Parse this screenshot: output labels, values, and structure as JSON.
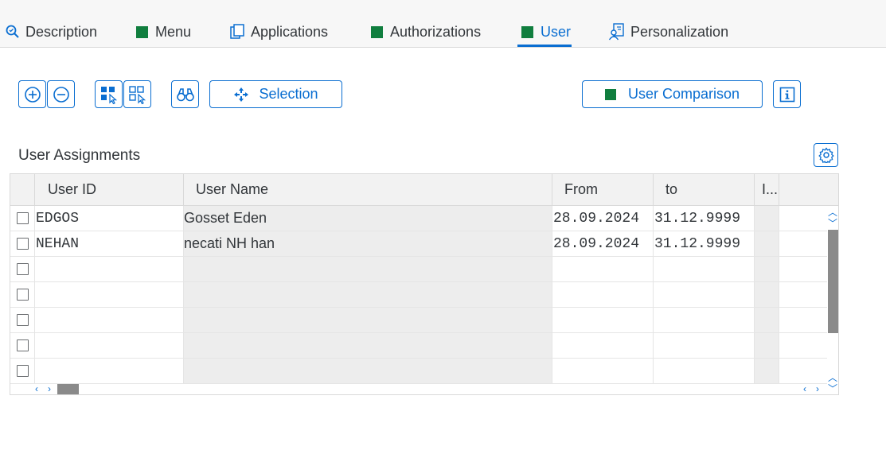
{
  "tabs": [
    {
      "label": "Description",
      "icon": "magnifier-icon"
    },
    {
      "label": "Menu",
      "icon": "green-square-icon"
    },
    {
      "label": "Applications",
      "icon": "copy-pages-icon"
    },
    {
      "label": "Authorizations",
      "icon": "green-square-icon"
    },
    {
      "label": "User",
      "icon": "green-square-icon",
      "active": true
    },
    {
      "label": "Personalization",
      "icon": "user-settings-icon"
    }
  ],
  "toolbar": {
    "selection_label": "Selection",
    "user_comparison_label": "User Comparison"
  },
  "section": {
    "title": "User Assignments"
  },
  "table": {
    "columns": [
      "User ID",
      "User Name",
      "From",
      "to",
      "I..."
    ],
    "rows": [
      {
        "user_id": "EDGOS",
        "user_name": "Gosset Eden",
        "from": "28.09.2024",
        "to": "31.12.9999"
      },
      {
        "user_id": "NEHAN",
        "user_name": "necati NH han",
        "from": "28.09.2024",
        "to": "31.12.9999"
      }
    ],
    "empty_rows": 5
  },
  "colors": {
    "accent": "#0a6ed1",
    "green_square": "#107e3e",
    "grey_column": "#ededed"
  }
}
